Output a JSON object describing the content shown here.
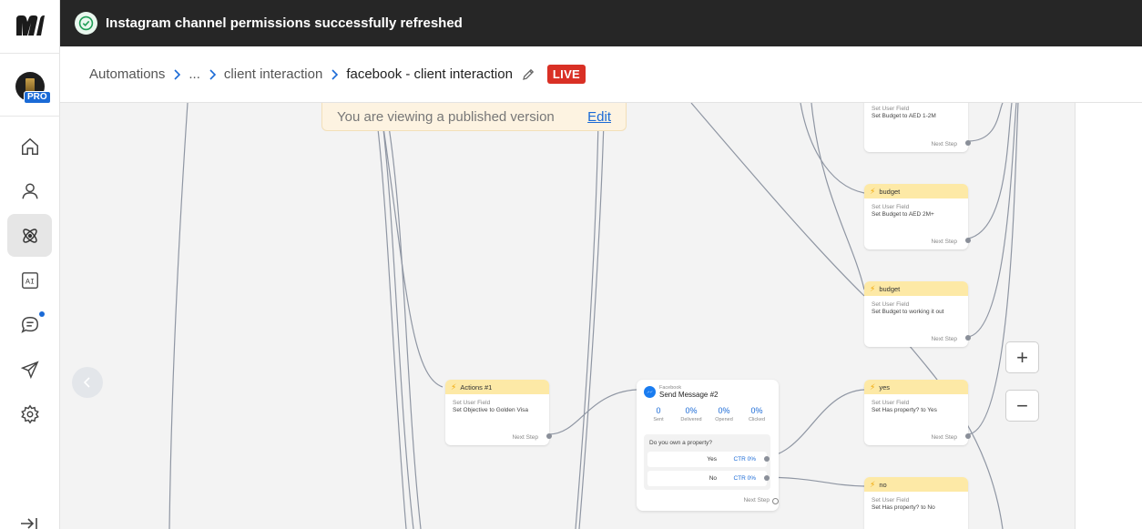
{
  "toast": {
    "message": "Instagram channel permissions successfully refreshed"
  },
  "sidebar": {
    "badge": "PRO",
    "items": [
      {
        "name": "home",
        "icon": "home-icon"
      },
      {
        "name": "contacts",
        "icon": "user-icon"
      },
      {
        "name": "automations",
        "icon": "atom-icon",
        "active": true
      },
      {
        "name": "ai",
        "icon": "ai-icon"
      },
      {
        "name": "messages",
        "icon": "chat-icon",
        "notification": true
      },
      {
        "name": "broadcasts",
        "icon": "send-icon"
      },
      {
        "name": "settings",
        "icon": "gear-icon"
      }
    ]
  },
  "header": {
    "breadcrumbs": [
      "Automations",
      "...",
      "client interaction",
      "facebook - client interaction"
    ],
    "status": "LIVE"
  },
  "banner": {
    "text": "You are viewing a published version",
    "edit_label": "Edit"
  },
  "cards": {
    "budget_top": {
      "type": "Set User Field",
      "text": "Set Budget to AED 1-2M",
      "next": "Next Step"
    },
    "budget_2m": {
      "title": "budget",
      "type": "Set User Field",
      "text": "Set Budget to AED 2M+",
      "next": "Next Step"
    },
    "budget_wio": {
      "title": "budget",
      "type": "Set User Field",
      "text": "Set Budget to working it out",
      "next": "Next Step"
    },
    "actions1": {
      "title": "Actions #1",
      "type": "Set User Field",
      "text": "Set Objective to Golden Visa",
      "next": "Next Step"
    },
    "yes": {
      "title": "yes",
      "type": "Set User Field",
      "text": "Set Has property? to Yes",
      "next": "Next Step"
    },
    "no": {
      "title": "no",
      "type": "Set User Field",
      "text": "Set Has property? to No"
    }
  },
  "send_message": {
    "channel": "Facebook",
    "title": "Send Message #2",
    "stats": [
      {
        "value": "0",
        "label": "Sent"
      },
      {
        "value": "0%",
        "label": "Delivered"
      },
      {
        "value": "0%",
        "label": "Opened"
      },
      {
        "value": "0%",
        "label": "Clicked"
      }
    ],
    "question": "Do you own a property?",
    "options": [
      {
        "label": "Yes",
        "ctr": "CTR 0%"
      },
      {
        "label": "No",
        "ctr": "CTR 0%"
      }
    ],
    "next": "Next Step"
  },
  "zoom": {
    "in_label": "+",
    "out_label": "−"
  }
}
